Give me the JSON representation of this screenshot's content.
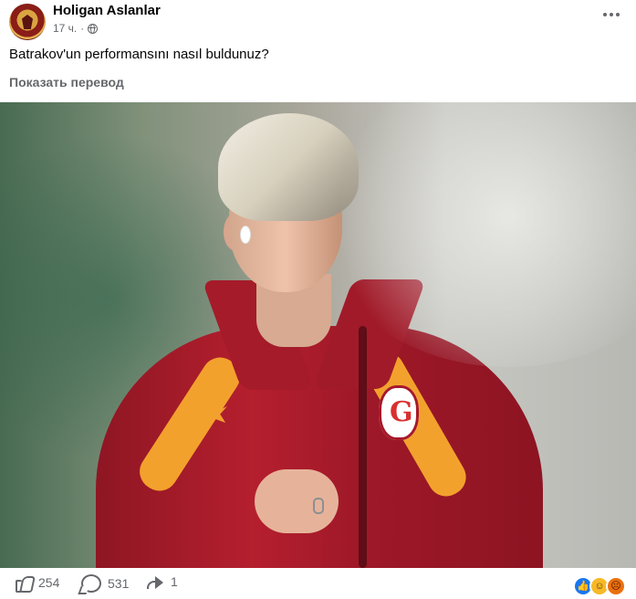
{
  "header": {
    "page_name": "Holigan Aslanlar",
    "time": "17 ч.",
    "dot": "·",
    "audience_icon": "globe-icon",
    "more_icon": "more-icon"
  },
  "post": {
    "text": "Batrakov'un performansını nasıl buldunuz?",
    "translation_link": "Показать перевод"
  },
  "photo": {
    "subject": "player-photo",
    "colors": {
      "shirt": "#b51f2e",
      "trim": "#f3a12d",
      "background_green": "#486b52"
    }
  },
  "actions": {
    "likes": "254",
    "comments": "531",
    "shares": "1",
    "icons": {
      "like": "thumb-up-icon",
      "comment": "comment-icon",
      "share": "share-icon"
    },
    "reaction_icons": [
      "like-reaction-icon",
      "haha-reaction-icon",
      "angry-reaction-icon"
    ],
    "reaction_colors": [
      "#1877f2",
      "#f7b928",
      "#e9710f"
    ]
  }
}
